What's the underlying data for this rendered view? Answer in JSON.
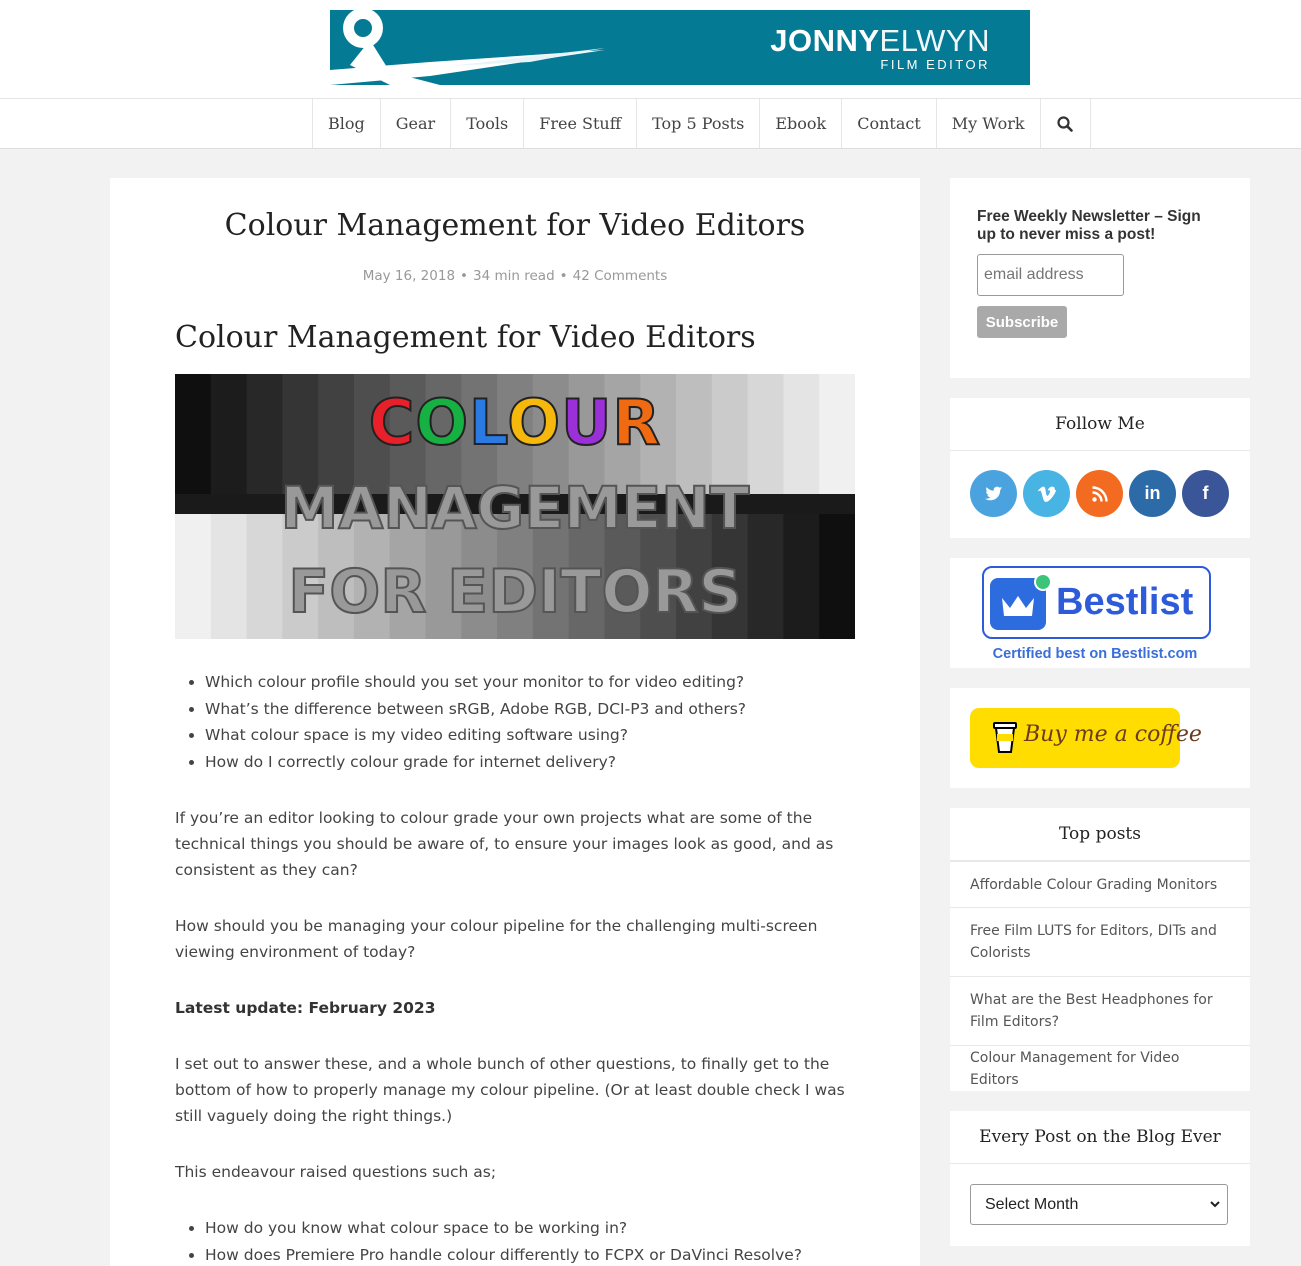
{
  "header": {
    "brand_bold": "JONNY",
    "brand_light": "ELWYN",
    "brand_sub": "FILM EDITOR"
  },
  "nav": {
    "items": [
      "Blog",
      "Gear",
      "Tools",
      "Free Stuff",
      "Top 5 Posts",
      "Ebook",
      "Contact",
      "My Work"
    ],
    "search_icon": "search-icon"
  },
  "article": {
    "title": "Colour Management for Video Editors",
    "meta": {
      "date": "May 16, 2018",
      "read_time": "34 min read",
      "comments": "42 Comments"
    },
    "heading": "Colour Management for Video Editors",
    "hero": {
      "line1_letters": [
        "C",
        "O",
        "L",
        "O",
        "U",
        "R"
      ],
      "line1_colors": [
        "#e8202a",
        "#17b043",
        "#2a7ae2",
        "#f6b80c",
        "#9b2fd8",
        "#f06a12"
      ],
      "line2": "MANAGEMENT",
      "line3": "FOR EDITORS"
    },
    "bullets1": [
      "Which colour profile should you set your monitor to for video editing?",
      "What’s the difference between sRGB, Adobe RGB, DCI-P3 and others?",
      "What colour space is my video editing software using?",
      "How do I correctly colour grade for internet delivery?"
    ],
    "para1": "If you’re an editor looking to colour grade your own projects what are some of the technical things you should be aware of, to ensure your images look as good, and as consistent as they can?",
    "para2": "How should you be managing your colour pipeline for the challenging multi-screen viewing environment of today?",
    "update": "Latest update: February 2023",
    "para3": "I set out to answer these, and a whole bunch of other questions, to finally get to the bottom of how to properly manage my colour pipeline. (Or at least double check I was still vaguely doing the right things.)",
    "para4": "This endeavour raised questions such as;",
    "bullets2": [
      "How do you know what colour space to be working in?",
      "How does Premiere Pro handle colour differently to FCPX or DaVinci Resolve?"
    ]
  },
  "sidebar": {
    "newsletter": {
      "title": "Free Weekly Newsletter – Sign up to never miss a post!",
      "placeholder": "email address",
      "button": "Subscribe"
    },
    "follow": {
      "title": "Follow Me",
      "icons": [
        {
          "name": "twitter-icon",
          "glyph": "t",
          "color": "#4aa3df"
        },
        {
          "name": "vimeo-icon",
          "glyph": "v",
          "color": "#48b4e3"
        },
        {
          "name": "rss-icon",
          "glyph": "rss",
          "color": "#f26b21"
        },
        {
          "name": "linkedin-icon",
          "glyph": "in",
          "color": "#2d6aa8"
        },
        {
          "name": "facebook-icon",
          "glyph": "f",
          "color": "#3b5698"
        }
      ]
    },
    "bestlist": {
      "logo_text": "Bestlist",
      "caption": "Certified best on Bestlist.com"
    },
    "coffee": {
      "label": "Buy me a coffee"
    },
    "top_posts": {
      "title": "Top posts",
      "items": [
        "Affordable Colour Grading Monitors",
        "Free Film LUTS for Editors, DITs and Colorists",
        "What are the Best Headphones for Film Editors?",
        "Colour Management for Video Editors"
      ]
    },
    "archive": {
      "title": "Every Post on the Blog Ever",
      "select_value": "Select Month"
    }
  }
}
